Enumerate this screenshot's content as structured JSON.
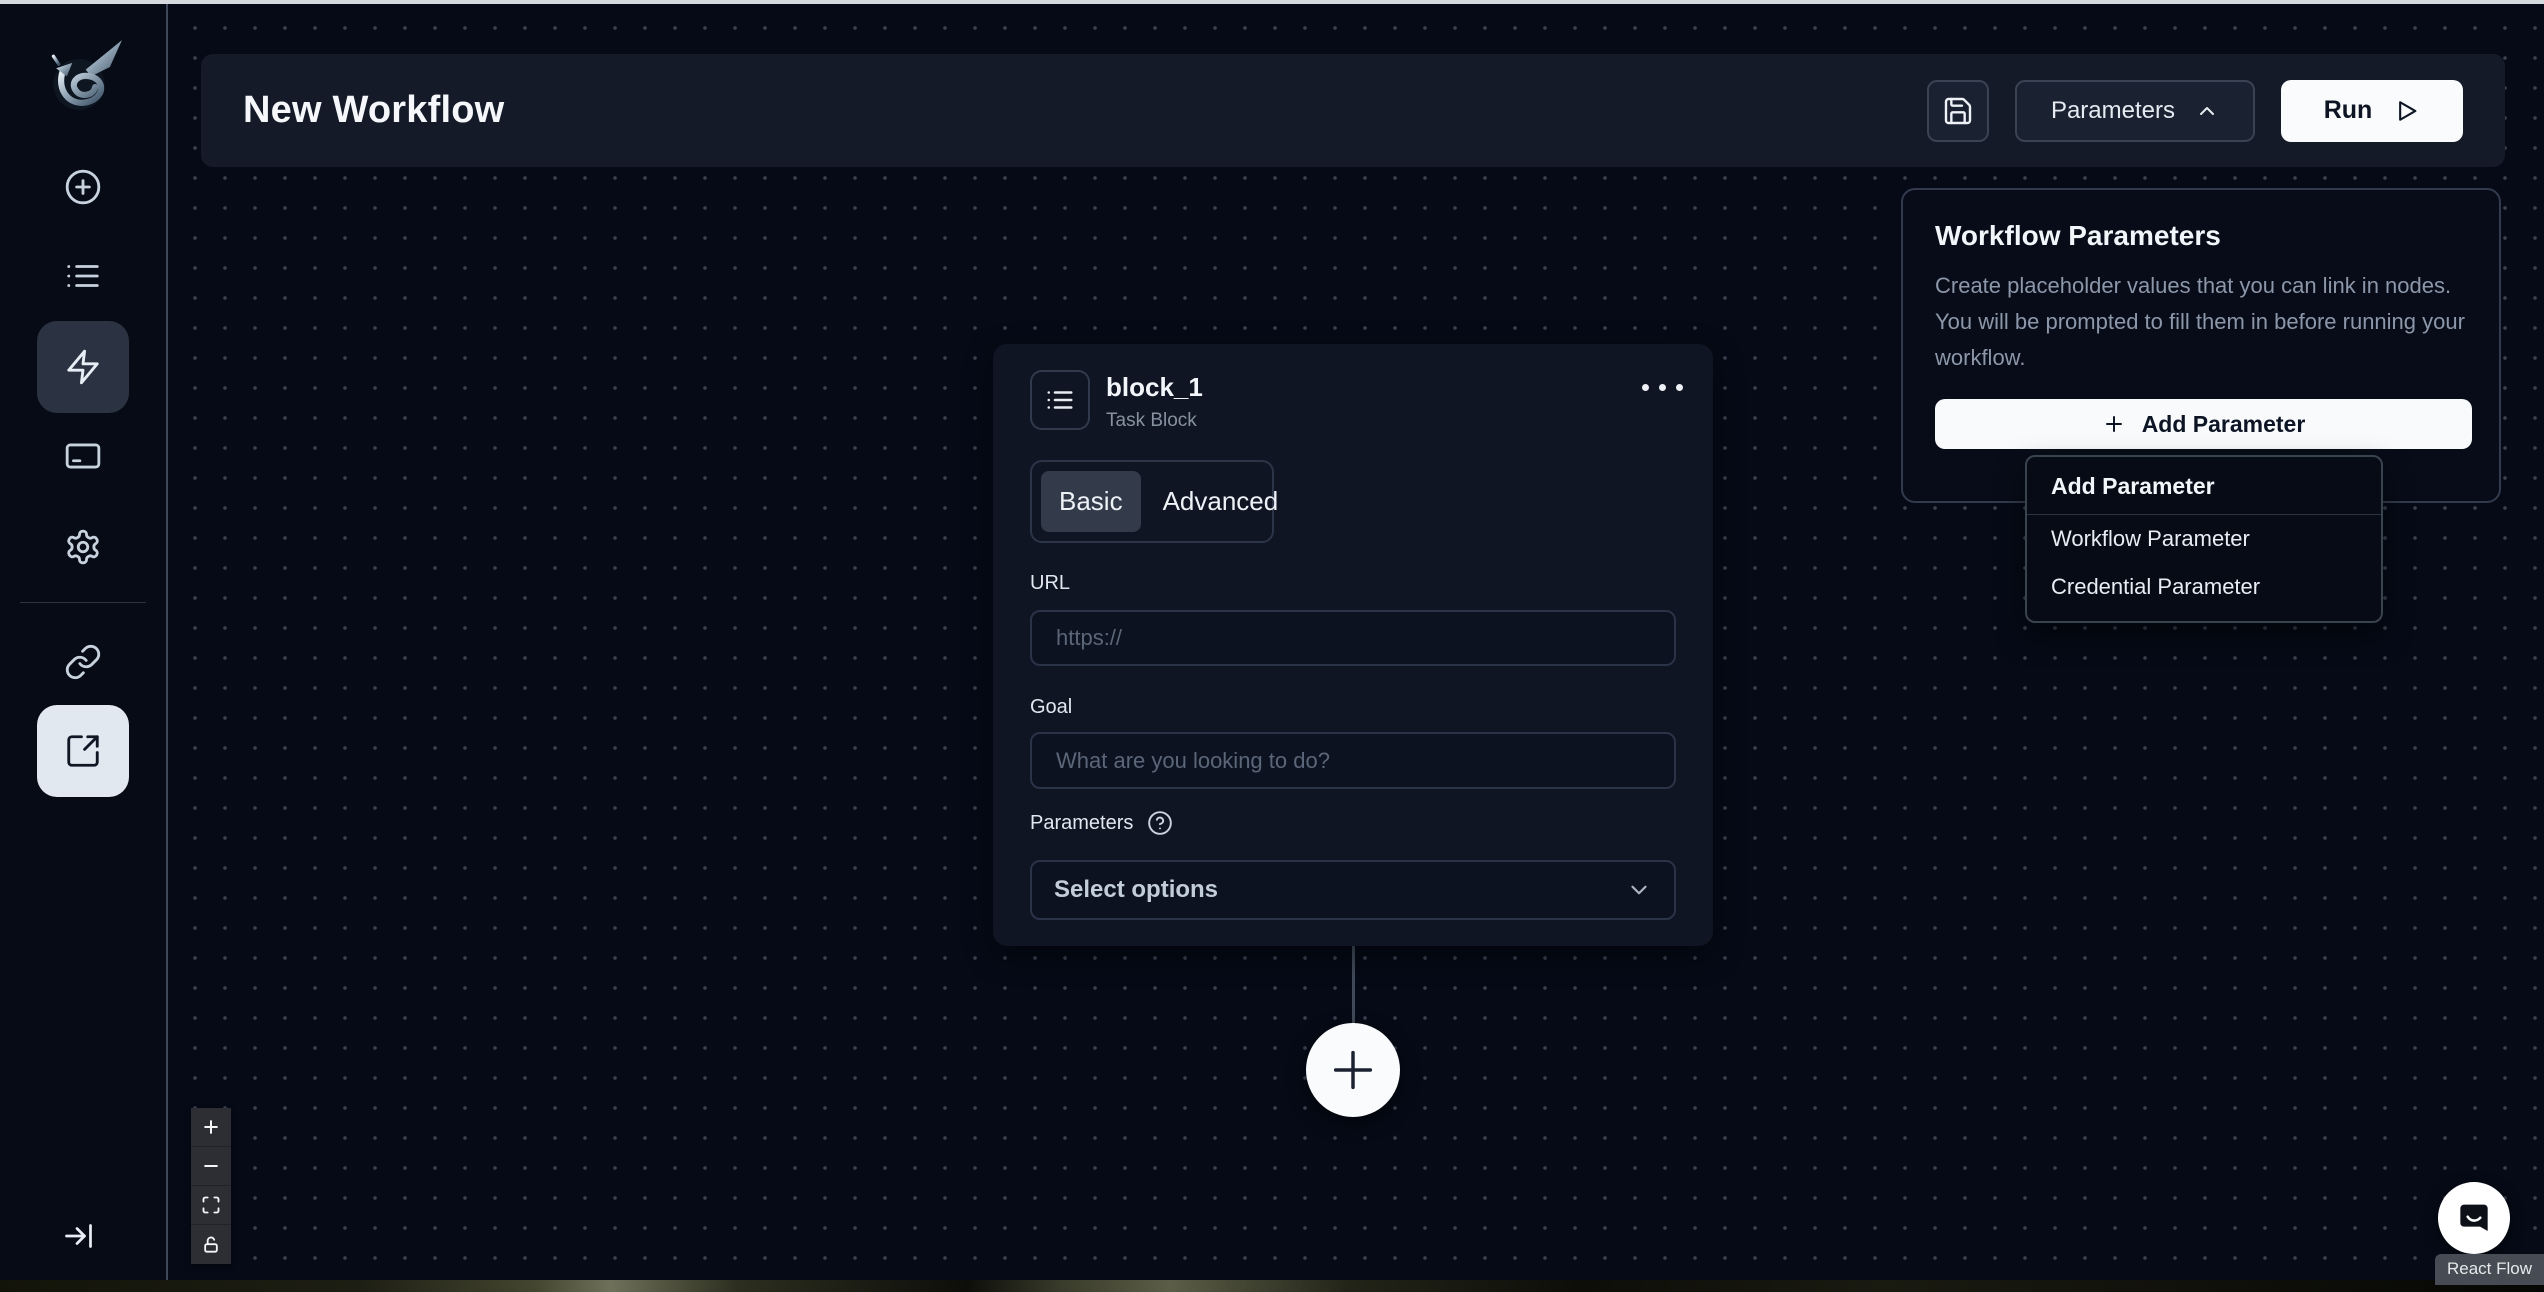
{
  "header": {
    "title": "New Workflow",
    "parameters_label": "Parameters",
    "run_label": "Run"
  },
  "sidebar": {
    "icons": [
      "dragon-logo",
      "plus-circle",
      "list",
      "zap",
      "credit-card",
      "settings",
      "link",
      "external-link",
      "collapse-right"
    ],
    "active_items": [
      "zap",
      "external-link"
    ]
  },
  "node": {
    "title": "block_1",
    "subtitle": "Task Block",
    "tabs": [
      {
        "label": "Basic",
        "active": true
      },
      {
        "label": "Advanced",
        "active": false
      }
    ],
    "url_label": "URL",
    "url_placeholder": "https://",
    "goal_label": "Goal",
    "goal_placeholder": "What are you looking to do?",
    "parameters_label": "Parameters",
    "select_placeholder": "Select options"
  },
  "panel": {
    "title": "Workflow Parameters",
    "description": "Create placeholder values that you can link in nodes. You will be prompted to fill them in before running your workflow.",
    "add_button": "Add Parameter"
  },
  "menu": {
    "header": "Add Parameter",
    "items": [
      "Workflow Parameter",
      "Credential Parameter"
    ]
  },
  "flow_controls": {
    "icons": [
      "zoom-in",
      "zoom-out",
      "fit-view",
      "lock-open"
    ]
  },
  "attribution": {
    "label": "React Flow"
  },
  "colors": {
    "canvas_bg": "#050a16",
    "sidebar_bg": "#060b16",
    "card_bg": "#0f1522",
    "header_bg": "#141a28",
    "accent_light": "#f8fafc",
    "active_nav_dark": "#2b3342",
    "active_nav_light": "#e2e8f0",
    "border": "#323b4d",
    "text_muted": "#8c97aa"
  }
}
